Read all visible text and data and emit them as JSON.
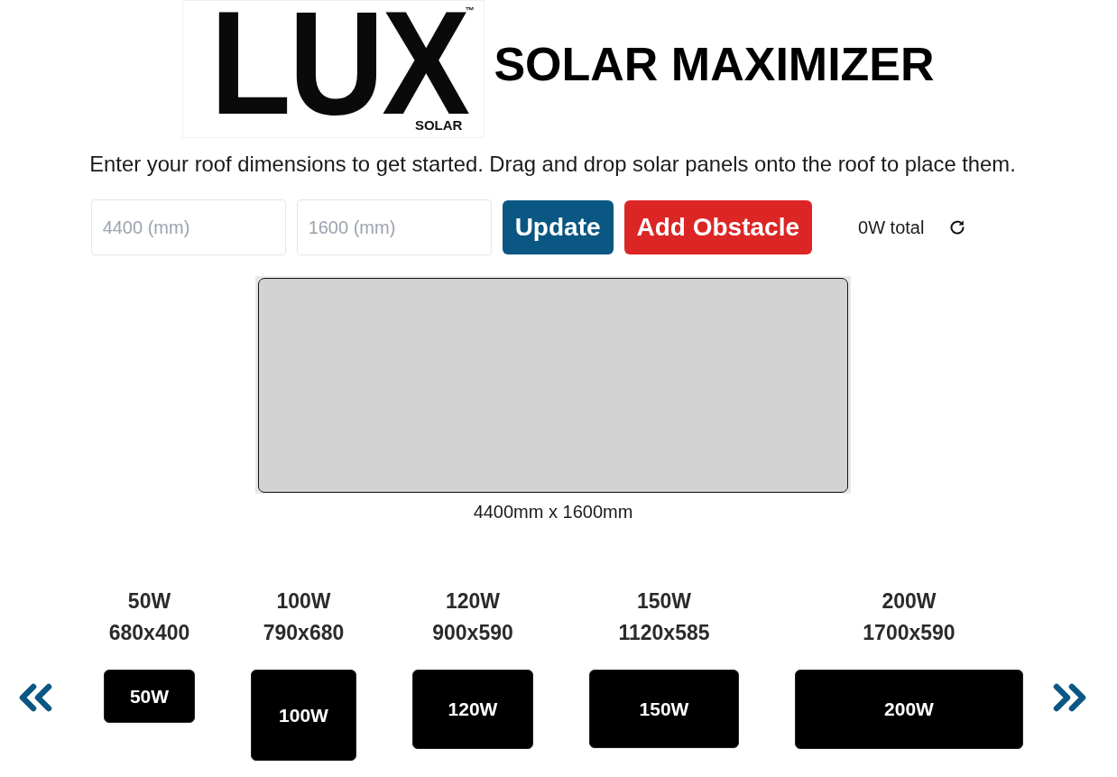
{
  "logo": {
    "wordmark": "LUX",
    "trademark": "™",
    "tagline": "SOLAR"
  },
  "title": "SOLAR MAXIMIZER",
  "instructions": "Enter your roof dimensions to get started. Drag and drop solar panels onto the roof to place them.",
  "roof_form": {
    "width_field": {
      "placeholder": "4400 (mm)"
    },
    "height_field": {
      "placeholder": "1600 (mm)"
    },
    "buttons": [
      {
        "label": "Update",
        "kind": "primary"
      },
      {
        "label": "Add Obstacle",
        "kind": "danger"
      }
    ],
    "total": "0W total"
  },
  "roof": {
    "dimensions": "4400mm x 1600mm"
  },
  "panels": [
    {
      "power": "50W",
      "size": "680x400",
      "tile_label": "50W"
    },
    {
      "power": "100W",
      "size": "790x680",
      "tile_label": "100W"
    },
    {
      "power": "120W",
      "size": "900x590",
      "tile_label": "120W"
    },
    {
      "power": "150W",
      "size": "1120x585",
      "tile_label": "150W"
    },
    {
      "power": "200W",
      "size": "1700x590",
      "tile_label": "200W"
    }
  ]
}
